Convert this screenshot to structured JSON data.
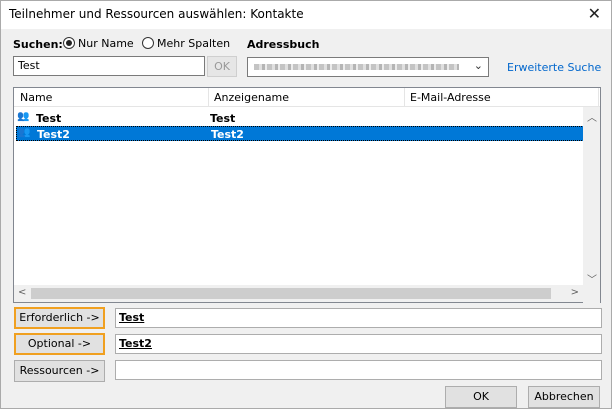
{
  "window": {
    "title": "Teilnehmer und Ressourcen auswählen: Kontakte"
  },
  "search": {
    "label": "Suchen:",
    "radio_name_only": "Nur Name",
    "radio_more_columns": "Mehr Spalten",
    "value": "Test",
    "ok_label": "OK"
  },
  "addressbook": {
    "label": "Adressbuch",
    "advanced_search": "Erweiterte Suche"
  },
  "table": {
    "columns": [
      "Name",
      "Anzeigename",
      "E-Mail-Adresse"
    ],
    "rows": [
      {
        "name": "Test",
        "display_name": "Test",
        "email": "",
        "selected": false
      },
      {
        "name": "Test2",
        "display_name": "Test2",
        "email": "",
        "selected": true
      }
    ]
  },
  "recipients": {
    "required_label": "Erforderlich ->",
    "required_value": "Test",
    "optional_label": "Optional ->",
    "optional_value": "Test2",
    "resources_label": "Ressourcen ->",
    "resources_value": ""
  },
  "footer": {
    "ok_label": "OK",
    "cancel_label": "Abbrechen"
  },
  "colors": {
    "selection": "#0078d7",
    "highlight_border": "#f0a020",
    "link": "#0066cc"
  },
  "icons": {
    "contact": "contact-group-icon",
    "close": "close-icon",
    "dropdown": "chevron-down-icon"
  }
}
